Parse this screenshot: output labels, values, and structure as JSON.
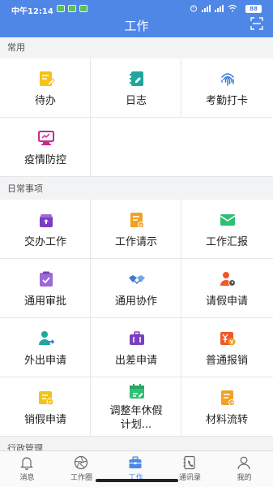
{
  "status": {
    "time": "中午12:14",
    "battery": "88"
  },
  "header": {
    "title": "工作"
  },
  "sections": [
    {
      "label": "常用"
    },
    {
      "label": "日常事项"
    },
    {
      "label": "行政管理"
    }
  ],
  "common": [
    {
      "label": "待办",
      "icon": "todo-icon"
    },
    {
      "label": "日志",
      "icon": "log-icon"
    },
    {
      "label": "考勤打卡",
      "icon": "fingerprint-icon"
    },
    {
      "label": "疫情防控",
      "icon": "monitor-icon"
    }
  ],
  "daily": [
    {
      "label": "交办工作",
      "icon": "inbox-icon"
    },
    {
      "label": "工作请示",
      "icon": "request-icon"
    },
    {
      "label": "工作汇报",
      "icon": "mail-icon"
    },
    {
      "label": "通用审批",
      "icon": "clipboard-check-icon"
    },
    {
      "label": "通用协作",
      "icon": "handshake-icon"
    },
    {
      "label": "请假申请",
      "icon": "person-clock-icon"
    },
    {
      "label": "外出申请",
      "icon": "person-out-icon"
    },
    {
      "label": "出差申请",
      "icon": "briefcase-icon"
    },
    {
      "label": "普通报销",
      "icon": "yen-icon"
    },
    {
      "label": "销假申请",
      "icon": "ticket-icon"
    },
    {
      "label": "调整年休假计划...",
      "icon": "calendar-edit-icon"
    },
    {
      "label": "材料流转",
      "icon": "doc-flow-icon"
    }
  ],
  "tabs": [
    {
      "label": "消息",
      "icon": "bell-icon"
    },
    {
      "label": "工作圈",
      "icon": "aperture-icon"
    },
    {
      "label": "工作",
      "icon": "briefcase-tab-icon"
    },
    {
      "label": "通讯录",
      "icon": "contacts-icon"
    },
    {
      "label": "我的",
      "icon": "user-icon"
    }
  ],
  "colors": {
    "primary": "#4f87e7",
    "yellow": "#f5c318",
    "teal": "#1fa6a0",
    "blue": "#3a7bd5",
    "magenta": "#c62b8b",
    "purple": "#7a3fc0",
    "orange": "#f0a126",
    "green": "#2fbf73",
    "red_orange": "#ef5a24"
  }
}
